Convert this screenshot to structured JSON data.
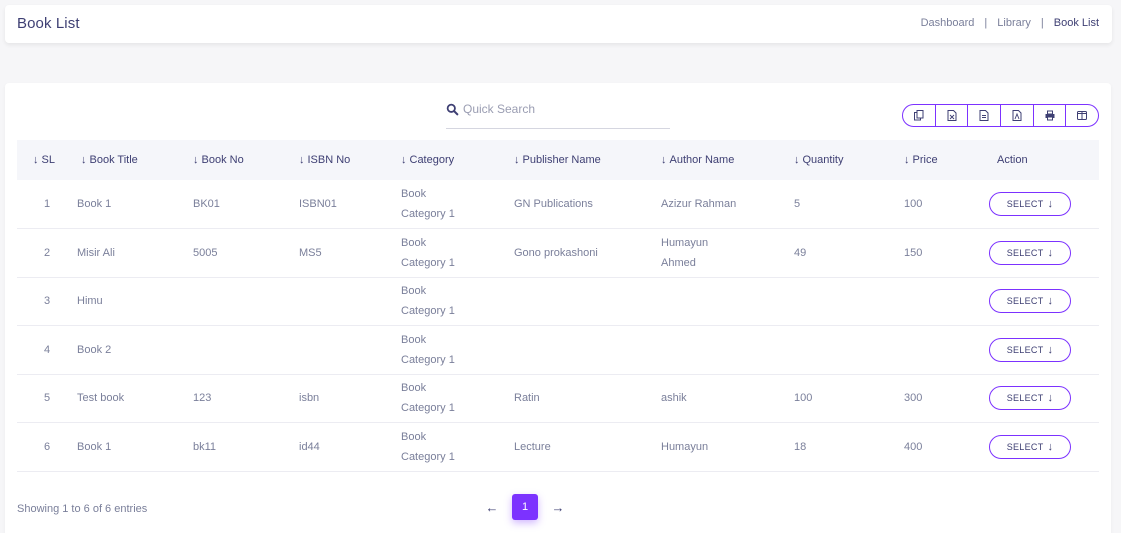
{
  "header": {
    "title": "Book List",
    "breadcrumb": [
      "Dashboard",
      "Library",
      "Book List"
    ]
  },
  "search": {
    "placeholder": "Quick Search",
    "value": ""
  },
  "export_buttons": [
    "copy-icon",
    "csv-icon",
    "excel-icon",
    "pdf-icon",
    "print-icon",
    "columns-icon"
  ],
  "table": {
    "columns": [
      "SL",
      "Book Title",
      "Book No",
      "ISBN No",
      "Category",
      "Publisher Name",
      "Author Name",
      "Quantity",
      "Price",
      "Action"
    ],
    "rows": [
      {
        "sl": "1",
        "title": "Book 1",
        "book_no": "BK01",
        "isbn": "ISBN01",
        "category_1": "Book",
        "category_2": "Category 1",
        "publisher": "GN Publications",
        "author_1": "Azizur Rahman",
        "author_2": "",
        "quantity": "5",
        "price": "100"
      },
      {
        "sl": "2",
        "title": "Misir Ali",
        "book_no": "5005",
        "isbn": "MS5",
        "category_1": "Book",
        "category_2": "Category 1",
        "publisher": "Gono prokashoni",
        "author_1": "Humayun",
        "author_2": "Ahmed",
        "quantity": "49",
        "price": "150"
      },
      {
        "sl": "3",
        "title": "Himu",
        "book_no": "",
        "isbn": "",
        "category_1": "Book",
        "category_2": "Category 1",
        "publisher": "",
        "author_1": "",
        "author_2": "",
        "quantity": "",
        "price": ""
      },
      {
        "sl": "4",
        "title": "Book 2",
        "book_no": "",
        "isbn": "",
        "category_1": "Book",
        "category_2": "Category 1",
        "publisher": "",
        "author_1": "",
        "author_2": "",
        "quantity": "",
        "price": ""
      },
      {
        "sl": "5",
        "title": "Test book",
        "book_no": "123",
        "isbn": "isbn",
        "category_1": "Book",
        "category_2": "Category 1",
        "publisher": "Ratin",
        "author_1": "ashik",
        "author_2": "",
        "quantity": "100",
        "price": "300"
      },
      {
        "sl": "6",
        "title": "Book 1",
        "book_no": "bk11",
        "isbn": "id44",
        "category_1": "Book",
        "category_2": "Category 1",
        "publisher": "Lecture",
        "author_1": "Humayun",
        "author_2": "",
        "quantity": "18",
        "price": "400"
      }
    ],
    "action_label": "SELECT"
  },
  "footer": {
    "info": "Showing 1 to 6 of 6 entries",
    "current_page": "1"
  },
  "colors": {
    "accent": "#7c32ff",
    "title": "#3e3f73",
    "text": "#7a7f9a"
  }
}
